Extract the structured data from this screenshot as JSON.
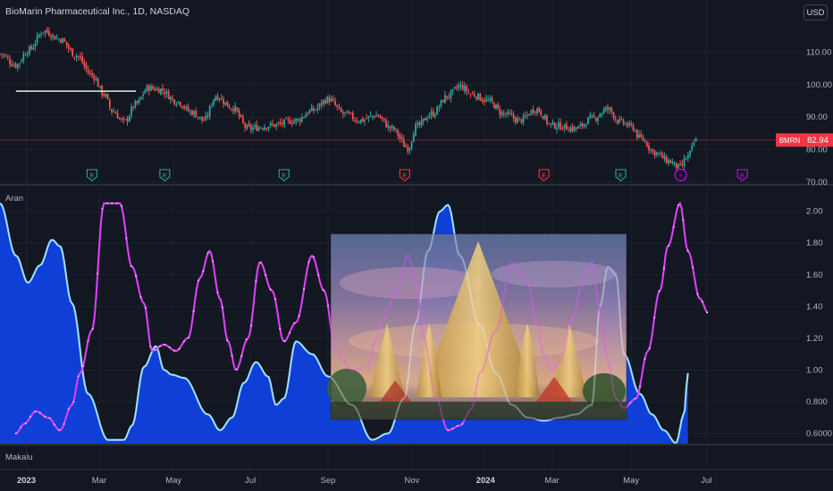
{
  "header": {
    "symbol_title": "BioMarin Pharmaceutical Inc., 1D, NASDAQ",
    "currency_button": "USD"
  },
  "indicator_label": "Aran",
  "footer_label": "Makalu",
  "colors": {
    "background": "#131722",
    "candle_up": "#26a69a",
    "candle_down": "#ef5350",
    "area_fill": "#0f3fd6",
    "area_line": "#7fd4ff",
    "magenta": "#e040fb",
    "price_tag": "#f23645",
    "earnings_green": "#22ab94",
    "earnings_red": "#f23645",
    "earnings_purple": "#d500f9"
  },
  "chart_data": [
    {
      "type": "candlestick",
      "title": "BioMarin Pharmaceutical Inc., 1D, NASDAQ",
      "ylim": [
        70,
        120
      ],
      "y_ticks": [
        "110.00",
        "100.00",
        "90.00",
        "80.00",
        "70.00"
      ],
      "last_price": {
        "symbol": "BMRN",
        "value": "82.94"
      },
      "x_ticks": [
        "2023",
        "Mar",
        "May",
        "Jul",
        "Sep",
        "Nov",
        "2024",
        "Mar",
        "May",
        "Jul"
      ],
      "close_anchors": [
        [
          0,
          109.5
        ],
        [
          0.02,
          106.0
        ],
        [
          0.035,
          110.5
        ],
        [
          0.055,
          116.5
        ],
        [
          0.075,
          114.0
        ],
        [
          0.095,
          109.0
        ],
        [
          0.115,
          103.0
        ],
        [
          0.13,
          97.0
        ],
        [
          0.14,
          92.0
        ],
        [
          0.155,
          88.5
        ],
        [
          0.17,
          94.0
        ],
        [
          0.185,
          99.0
        ],
        [
          0.2,
          98.5
        ],
        [
          0.22,
          95.0
        ],
        [
          0.24,
          91.5
        ],
        [
          0.255,
          89.0
        ],
        [
          0.27,
          96.5
        ],
        [
          0.29,
          93.0
        ],
        [
          0.31,
          86.5
        ],
        [
          0.34,
          87.5
        ],
        [
          0.37,
          89.0
        ],
        [
          0.39,
          92.0
        ],
        [
          0.41,
          95.5
        ],
        [
          0.43,
          91.0
        ],
        [
          0.45,
          89.0
        ],
        [
          0.47,
          90.5
        ],
        [
          0.49,
          86.5
        ],
        [
          0.51,
          80.5
        ],
        [
          0.52,
          87.0
        ],
        [
          0.54,
          91.0
        ],
        [
          0.56,
          96.5
        ],
        [
          0.575,
          99.5
        ],
        [
          0.59,
          97.0
        ],
        [
          0.61,
          95.0
        ],
        [
          0.63,
          91.0
        ],
        [
          0.65,
          89.0
        ],
        [
          0.67,
          92.5
        ],
        [
          0.69,
          87.5
        ],
        [
          0.72,
          86.5
        ],
        [
          0.74,
          89.5
        ],
        [
          0.76,
          92.5
        ],
        [
          0.775,
          88.5
        ],
        [
          0.79,
          87.0
        ],
        [
          0.8,
          83.5
        ],
        [
          0.82,
          79.0
        ],
        [
          0.835,
          76.5
        ],
        [
          0.85,
          74.5
        ],
        [
          0.86,
          78.0
        ],
        [
          0.87,
          82.9
        ]
      ],
      "horizontal_line": {
        "value": 98.0,
        "x_range": [
          0.02,
          0.17
        ]
      },
      "earnings_markers": [
        {
          "x": 0.115,
          "label": "E",
          "color": "green"
        },
        {
          "x": 0.206,
          "label": "E",
          "color": "green"
        },
        {
          "x": 0.355,
          "label": "E",
          "color": "green"
        },
        {
          "x": 0.506,
          "label": "E",
          "color": "red"
        },
        {
          "x": 0.68,
          "label": "E",
          "color": "red"
        },
        {
          "x": 0.776,
          "label": "E",
          "color": "green"
        },
        {
          "x": 0.851,
          "label": "⚡",
          "color": "purple"
        },
        {
          "x": 0.928,
          "label": "E",
          "color": "purple"
        }
      ]
    },
    {
      "type": "area",
      "name": "Aran",
      "ylim": [
        0.53,
        2.15
      ],
      "y_ticks": [
        "2.00",
        "1.80",
        "1.60",
        "1.40",
        "1.20",
        "1.00",
        "0.800",
        "0.6000"
      ],
      "series": [
        {
          "style": "area",
          "points": [
            [
              0,
              2.05
            ],
            [
              0.02,
              1.72
            ],
            [
              0.035,
              1.55
            ],
            [
              0.05,
              1.66
            ],
            [
              0.065,
              1.82
            ],
            [
              0.075,
              1.78
            ],
            [
              0.09,
              1.42
            ],
            [
              0.11,
              0.85
            ],
            [
              0.135,
              0.56
            ],
            [
              0.155,
              0.56
            ],
            [
              0.165,
              0.65
            ],
            [
              0.18,
              1.02
            ],
            [
              0.195,
              1.15
            ],
            [
              0.205,
              1.0
            ],
            [
              0.215,
              0.97
            ],
            [
              0.23,
              0.95
            ],
            [
              0.26,
              0.72
            ],
            [
              0.275,
              0.62
            ],
            [
              0.29,
              0.7
            ],
            [
              0.305,
              0.92
            ],
            [
              0.32,
              1.05
            ],
            [
              0.335,
              0.96
            ],
            [
              0.345,
              0.78
            ],
            [
              0.355,
              0.82
            ],
            [
              0.37,
              1.18
            ],
            [
              0.39,
              1.1
            ],
            [
              0.41,
              0.96
            ],
            [
              0.44,
              0.78
            ],
            [
              0.465,
              0.56
            ],
            [
              0.485,
              0.6
            ],
            [
              0.505,
              0.82
            ],
            [
              0.52,
              1.3
            ],
            [
              0.535,
              1.75
            ],
            [
              0.55,
              2.0
            ],
            [
              0.56,
              2.04
            ],
            [
              0.575,
              1.72
            ],
            [
              0.6,
              1.28
            ],
            [
              0.62,
              0.98
            ],
            [
              0.64,
              0.78
            ],
            [
              0.66,
              0.7
            ],
            [
              0.68,
              0.68
            ],
            [
              0.7,
              0.7
            ],
            [
              0.72,
              0.72
            ],
            [
              0.74,
              0.78
            ],
            [
              0.75,
              1.4
            ],
            [
              0.76,
              1.65
            ],
            [
              0.77,
              1.6
            ],
            [
              0.78,
              1.1
            ],
            [
              0.8,
              0.85
            ],
            [
              0.815,
              0.72
            ],
            [
              0.83,
              0.62
            ],
            [
              0.845,
              0.54
            ],
            [
              0.855,
              0.72
            ],
            [
              0.86,
              0.98
            ]
          ]
        },
        {
          "style": "line",
          "points": [
            [
              0.02,
              0.6
            ],
            [
              0.03,
              0.66
            ],
            [
              0.045,
              0.74
            ],
            [
              0.06,
              0.7
            ],
            [
              0.075,
              0.62
            ],
            [
              0.09,
              0.78
            ],
            [
              0.1,
              0.98
            ],
            [
              0.115,
              1.25
            ],
            [
              0.13,
              2.05
            ],
            [
              0.15,
              2.05
            ],
            [
              0.165,
              1.65
            ],
            [
              0.18,
              1.42
            ],
            [
              0.19,
              1.12
            ],
            [
              0.205,
              1.16
            ],
            [
              0.22,
              1.12
            ],
            [
              0.235,
              1.2
            ],
            [
              0.25,
              1.58
            ],
            [
              0.262,
              1.75
            ],
            [
              0.275,
              1.45
            ],
            [
              0.285,
              1.18
            ],
            [
              0.295,
              1.0
            ],
            [
              0.31,
              1.2
            ],
            [
              0.325,
              1.68
            ],
            [
              0.34,
              1.5
            ],
            [
              0.355,
              1.18
            ],
            [
              0.37,
              1.3
            ],
            [
              0.39,
              1.72
            ],
            [
              0.405,
              1.5
            ],
            [
              0.42,
              1.12
            ],
            [
              0.44,
              1.0
            ],
            [
              0.46,
              1.02
            ],
            [
              0.47,
              1.2
            ],
            [
              0.48,
              1.32
            ],
            [
              0.495,
              1.5
            ],
            [
              0.51,
              1.72
            ],
            [
              0.52,
              1.55
            ],
            [
              0.53,
              1.2
            ],
            [
              0.545,
              0.82
            ],
            [
              0.56,
              0.62
            ],
            [
              0.575,
              0.65
            ],
            [
              0.59,
              0.76
            ],
            [
              0.6,
              0.98
            ],
            [
              0.62,
              1.25
            ],
            [
              0.64,
              1.68
            ],
            [
              0.66,
              1.55
            ],
            [
              0.67,
              1.32
            ],
            [
              0.68,
              1.1
            ],
            [
              0.69,
              1.0
            ],
            [
              0.7,
              1.05
            ],
            [
              0.715,
              1.32
            ],
            [
              0.73,
              1.58
            ],
            [
              0.74,
              1.68
            ],
            [
              0.75,
              1.38
            ],
            [
              0.76,
              1.05
            ],
            [
              0.77,
              0.82
            ],
            [
              0.78,
              0.76
            ],
            [
              0.795,
              0.82
            ],
            [
              0.81,
              1.12
            ],
            [
              0.825,
              1.5
            ],
            [
              0.835,
              1.78
            ],
            [
              0.85,
              2.05
            ],
            [
              0.86,
              1.75
            ],
            [
              0.875,
              1.45
            ],
            [
              0.885,
              1.36
            ]
          ]
        }
      ]
    }
  ]
}
